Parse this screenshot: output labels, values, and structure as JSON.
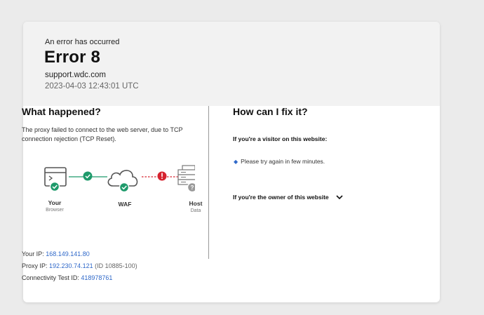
{
  "header": {
    "subtitle": "An error has occurred",
    "title": "Error 8",
    "host": "support.wdc.com",
    "timestamp": "2023-04-03 12:43:01 UTC"
  },
  "what_happened": {
    "title": "What happened?",
    "description": "The proxy failed to connect to the web server, due to TCP connection rejection (TCP Reset)."
  },
  "diagram": {
    "nodes": [
      {
        "label": "Your",
        "sublabel": "Browser",
        "status": "ok",
        "icon": "browser-icon"
      },
      {
        "label": "WAF",
        "sublabel": "",
        "status": "ok",
        "icon": "cloud-icon"
      },
      {
        "label": "Host",
        "sublabel": "Data",
        "status": "unknown",
        "icon": "server-icon"
      }
    ],
    "links": [
      {
        "status": "ok",
        "color": "#1e9a6b"
      },
      {
        "status": "error",
        "color": "#d6232f"
      }
    ]
  },
  "info": {
    "ip_label": "Your IP:",
    "ip_value": "168.149.141.80",
    "proxy_label": "Proxy IP:",
    "proxy_value": "192.230.74.121",
    "proxy_id": "(ID 10885-100)",
    "test_label": "Connectivity Test ID:",
    "test_value": "418978761"
  },
  "fix": {
    "title": "How can I fix it?",
    "visitor_heading": "If you're a visitor on this website:",
    "visitor_tip": "Please try again in few minutes.",
    "owner_heading": "If you're the owner of this website"
  },
  "colors": {
    "ok": "#1e9a6b",
    "error": "#d6232f",
    "link": "#2f68c9",
    "header_bg": "#f2f2f2",
    "page_bg": "#ebebeb"
  }
}
